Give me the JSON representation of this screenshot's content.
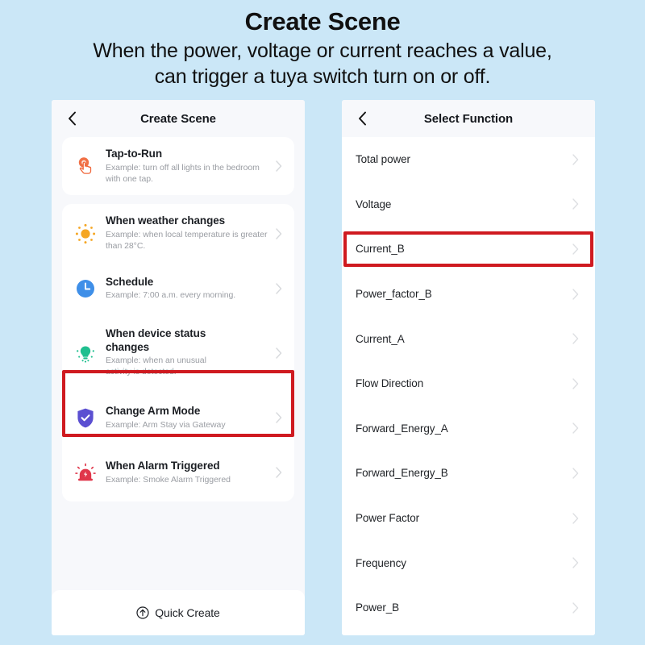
{
  "header": {
    "title": "Create Scene",
    "subtitle_line1": "When the power, voltage or current reaches a value,",
    "subtitle_line2": "can trigger a tuya switch turn on or off."
  },
  "colors": {
    "page_background": "#cbe7f7",
    "panel_background": "#f7f8fb",
    "card_background": "#ffffff",
    "highlight_red": "#cf1a20",
    "tap_icon": "#f0683c",
    "weather_icon": "#f5a623",
    "schedule_icon": "#3f8fe8",
    "device_icon": "#1fbf8f",
    "arm_icon": "#5b4fd1",
    "alarm_icon": "#e0364a",
    "title_text": "#1c1f24",
    "desc_text": "#9a9da3"
  },
  "left_panel": {
    "back_icon": "chevron-left-icon",
    "title": "Create Scene",
    "groups": [
      {
        "items": [
          {
            "icon": "tap-to-run-icon",
            "title": "Tap-to-Run",
            "desc": "Example: turn off all lights in the bedroom with one tap.",
            "chevron": "chevron-right-icon",
            "highlighted": false
          }
        ]
      },
      {
        "items": [
          {
            "icon": "sun-weather-icon",
            "title": "When weather changes",
            "desc": "Example: when local temperature is greater than 28°C.",
            "chevron": "chevron-right-icon",
            "highlighted": false
          },
          {
            "icon": "clock-schedule-icon",
            "title": "Schedule",
            "desc": "Example: 7:00 a.m. every morning.",
            "chevron": "chevron-right-icon",
            "highlighted": false
          },
          {
            "icon": "light-bulb-device-icon",
            "title": "When device status changes",
            "desc": "Example: when an unusual activity is detected.",
            "chevron": "chevron-right-icon",
            "highlighted": true
          },
          {
            "icon": "shield-check-icon",
            "title": "Change Arm Mode",
            "desc": "Example: Arm Stay via Gateway",
            "chevron": "chevron-right-icon",
            "highlighted": false
          },
          {
            "icon": "alarm-siren-icon",
            "title": "When Alarm Triggered",
            "desc": "Example: Smoke Alarm Triggered",
            "chevron": "chevron-right-icon",
            "highlighted": false
          }
        ]
      }
    ],
    "quick_create": {
      "icon": "arrow-up-circle-icon",
      "label": "Quick Create"
    }
  },
  "right_panel": {
    "back_icon": "chevron-left-icon",
    "title": "Select Function",
    "functions": [
      {
        "label": "Total power",
        "chevron": "chevron-right-icon",
        "highlighted": false
      },
      {
        "label": "Voltage",
        "chevron": "chevron-right-icon",
        "highlighted": false
      },
      {
        "label": "Current_B",
        "chevron": "chevron-right-icon",
        "highlighted": true
      },
      {
        "label": "Power_factor_B",
        "chevron": "chevron-right-icon",
        "highlighted": false
      },
      {
        "label": "Current_A",
        "chevron": "chevron-right-icon",
        "highlighted": false
      },
      {
        "label": "Flow Direction",
        "chevron": "chevron-right-icon",
        "highlighted": false
      },
      {
        "label": "Forward_Energy_A",
        "chevron": "chevron-right-icon",
        "highlighted": false
      },
      {
        "label": "Forward_Energy_B",
        "chevron": "chevron-right-icon",
        "highlighted": false
      },
      {
        "label": "Power Factor",
        "chevron": "chevron-right-icon",
        "highlighted": false
      },
      {
        "label": "Frequency",
        "chevron": "chevron-right-icon",
        "highlighted": false
      },
      {
        "label": "Power_B",
        "chevron": "chevron-right-icon",
        "highlighted": false
      }
    ]
  }
}
